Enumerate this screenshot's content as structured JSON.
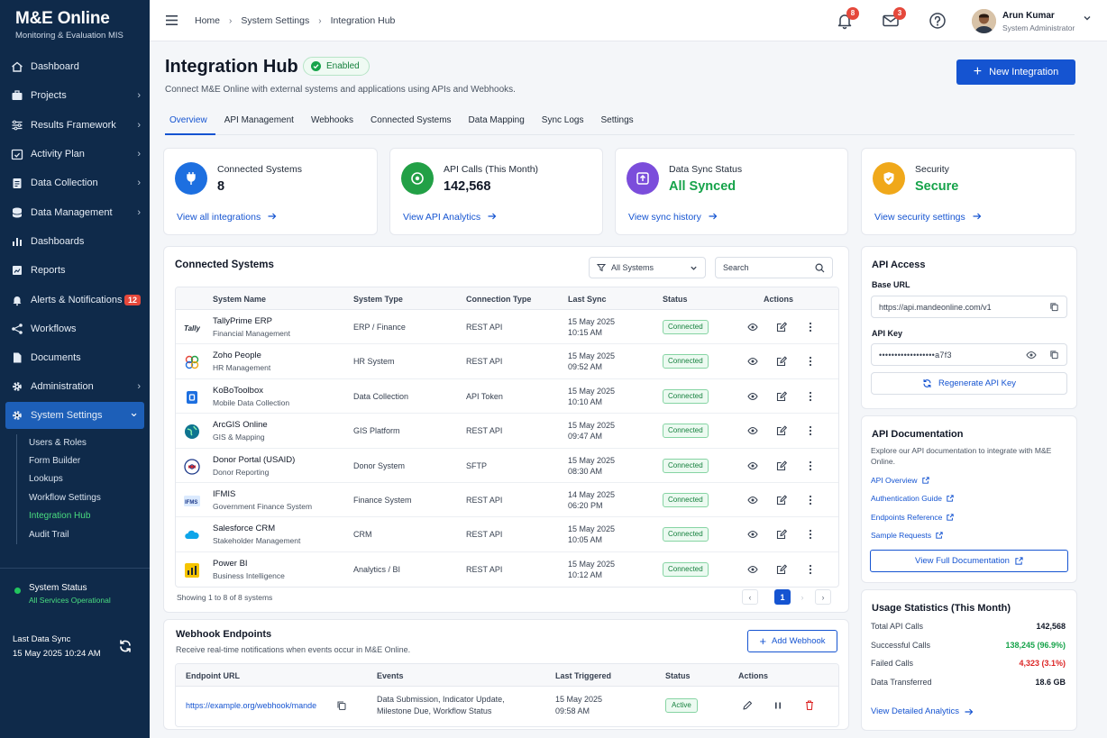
{
  "brand": {
    "title": "M&E Online",
    "subtitle": "Monitoring & Evaluation MIS"
  },
  "sidebar": {
    "items": [
      {
        "label": "Dashboard",
        "icon": "home-icon",
        "chevron": false
      },
      {
        "label": "Projects",
        "icon": "briefcase-icon",
        "chevron": true
      },
      {
        "label": "Results Framework",
        "icon": "sliders-icon",
        "chevron": true
      },
      {
        "label": "Activity Plan",
        "icon": "calendar-check-icon",
        "chevron": true
      },
      {
        "label": "Data Collection",
        "icon": "clipboard-icon",
        "chevron": true
      },
      {
        "label": "Data Management",
        "icon": "database-icon",
        "chevron": true
      },
      {
        "label": "Dashboards",
        "icon": "bar-chart-icon",
        "chevron": false
      },
      {
        "label": "Reports",
        "icon": "report-icon",
        "chevron": false
      },
      {
        "label": "Alerts & Notifications",
        "icon": "bell-icon",
        "chevron": false,
        "badge": "12"
      },
      {
        "label": "Workflows",
        "icon": "workflow-icon",
        "chevron": false
      },
      {
        "label": "Documents",
        "icon": "document-icon",
        "chevron": false
      },
      {
        "label": "Administration",
        "icon": "gear-icon",
        "chevron": true
      },
      {
        "label": "System Settings",
        "icon": "gear-icon",
        "chevron": true,
        "active": true
      }
    ],
    "subitems": [
      "Users & Roles",
      "Form Builder",
      "Lookups",
      "Workflow Settings",
      "Integration Hub",
      "Audit Trail"
    ],
    "active_subitem": "Integration Hub",
    "system_status": {
      "label": "System Status",
      "value": "All Services Operational"
    },
    "last_sync": {
      "label": "Last Data Sync",
      "value": "15 May 2025 10:24 AM"
    }
  },
  "topbar": {
    "breadcrumb": [
      "Home",
      "System Settings",
      "Integration Hub"
    ],
    "notifications_count": "8",
    "messages_count": "3",
    "user": {
      "name": "Arun Kumar",
      "role": "System Administrator"
    }
  },
  "page": {
    "title": "Integration Hub",
    "status": "Enabled",
    "description": "Connect M&E Online with external systems and applications using APIs and Webhooks.",
    "new_button": "New Integration",
    "tabs": [
      "Overview",
      "API Management",
      "Webhooks",
      "Connected Systems",
      "Data Mapping",
      "Sync Logs",
      "Settings"
    ],
    "active_tab": "Overview"
  },
  "stats": [
    {
      "label": "Connected Systems",
      "value": "8",
      "link": "View all integrations",
      "color": "#1d6fe0",
      "icon": "plug-icon"
    },
    {
      "label": "API Calls (This Month)",
      "value": "142,568",
      "link": "View API Analytics",
      "color": "#22a046",
      "icon": "api-icon"
    },
    {
      "label": "Data Sync Status",
      "value": "All Synced",
      "link": "View sync history",
      "color": "#7b4ddb",
      "icon": "sync-icon",
      "value_color": "#16a34a"
    },
    {
      "label": "Security",
      "value": "Secure",
      "link": "View security settings",
      "color": "#f0a81a",
      "icon": "shield-icon",
      "value_color": "#16a34a"
    }
  ],
  "connected_systems": {
    "title": "Connected Systems",
    "filter": "All Systems",
    "search_placeholder": "Search",
    "columns": [
      "System Name",
      "System Type",
      "Connection Type",
      "Last Sync",
      "Status",
      "Actions"
    ],
    "rows": [
      {
        "name": "TallyPrime ERP",
        "sub": "Financial Management",
        "type": "ERP / Finance",
        "conn": "REST API",
        "date": "15 May 2025",
        "time": "10:15 AM",
        "status": "Connected",
        "logo": "tally-logo-icon"
      },
      {
        "name": "Zoho People",
        "sub": "HR Management",
        "type": "HR System",
        "conn": "REST API",
        "date": "15 May 2025",
        "time": "09:52 AM",
        "status": "Connected",
        "logo": "zoho-logo-icon"
      },
      {
        "name": "KoBoToolbox",
        "sub": "Mobile Data Collection",
        "type": "Data Collection",
        "conn": "API Token",
        "date": "15 May 2025",
        "time": "10:10 AM",
        "status": "Connected",
        "logo": "kobo-logo-icon"
      },
      {
        "name": "ArcGIS Online",
        "sub": "GIS & Mapping",
        "type": "GIS Platform",
        "conn": "REST API",
        "date": "15 May 2025",
        "time": "09:47 AM",
        "status": "Connected",
        "logo": "globe-logo-icon"
      },
      {
        "name": "Donor Portal (USAID)",
        "sub": "Donor Reporting",
        "type": "Donor System",
        "conn": "SFTP",
        "date": "15 May 2025",
        "time": "08:30 AM",
        "status": "Connected",
        "logo": "usaid-logo-icon"
      },
      {
        "name": "IFMIS",
        "sub": "Government Finance System",
        "type": "Finance System",
        "conn": "REST API",
        "date": "14 May 2025",
        "time": "06:20 PM",
        "status": "Connected",
        "logo": "ifmis-logo-icon"
      },
      {
        "name": "Salesforce CRM",
        "sub": "Stakeholder Management",
        "type": "CRM",
        "conn": "REST API",
        "date": "15 May 2025",
        "time": "10:05 AM",
        "status": "Connected",
        "logo": "cloud-logo-icon"
      },
      {
        "name": "Power BI",
        "sub": "Business Intelligence",
        "type": "Analytics / BI",
        "conn": "REST API",
        "date": "15 May 2025",
        "time": "10:12 AM",
        "status": "Connected",
        "logo": "powerbi-logo-icon"
      }
    ],
    "showing": "Showing 1 to 8 of 8 systems",
    "current_page": "1"
  },
  "webhooks": {
    "title": "Webhook Endpoints",
    "description": "Receive real-time notifications when events occur in M&E Online.",
    "add_button": "Add Webhook",
    "columns": [
      "Endpoint URL",
      "Events",
      "Last Triggered",
      "Status",
      "Actions"
    ],
    "rows": [
      {
        "url": "https://example.org/webhook/mande",
        "events_line1": "Data Submission, Indicator Update,",
        "events_line2": "Milestone Due, Workflow Status",
        "date": "15 May 2025",
        "time": "09:58 AM",
        "status": "Active"
      }
    ]
  },
  "api_access": {
    "title": "API Access",
    "base_url_label": "Base URL",
    "base_url": "https://api.mandeonline.com/v1",
    "api_key_label": "API Key",
    "api_key": "••••••••••••••••••a7f3",
    "regen_button": "Regenerate API Key"
  },
  "api_docs": {
    "title": "API Documentation",
    "description": "Explore our API documentation to integrate with M&E Online.",
    "links": [
      "API Overview",
      "Authentication Guide",
      "Endpoints Reference",
      "Sample Requests"
    ],
    "button": "View Full Documentation"
  },
  "usage": {
    "title": "Usage Statistics (This Month)",
    "rows": [
      {
        "label": "Total API Calls",
        "value": "142,568",
        "color": "#111827"
      },
      {
        "label": "Successful Calls",
        "value": "138,245 (96.9%)",
        "color": "#16a34a"
      },
      {
        "label": "Failed Calls",
        "value": "4,323 (3.1%)",
        "color": "#dc2626"
      },
      {
        "label": "Data Transferred",
        "value": "18.6 GB",
        "color": "#111827"
      }
    ],
    "link": "View Detailed Analytics"
  }
}
